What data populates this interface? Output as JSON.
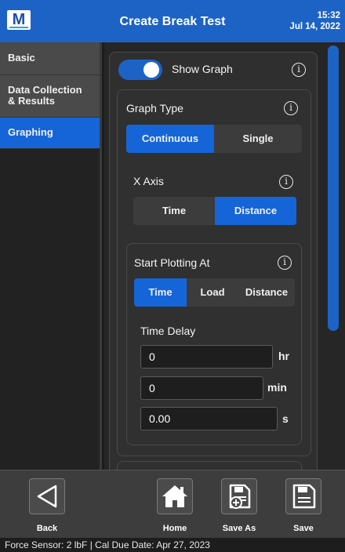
{
  "header": {
    "logo_text": "M",
    "title": "Create Break Test",
    "time": "15:32",
    "date": "Jul 14, 2022"
  },
  "sidebar": {
    "items": [
      {
        "label": "Basic"
      },
      {
        "label": "Data Collection\n& Results"
      },
      {
        "label": "Graphing"
      }
    ]
  },
  "graphing": {
    "show_graph_label": "Show Graph",
    "show_graph_on": true,
    "graph_type": {
      "label": "Graph Type",
      "options": [
        "Continuous",
        "Single"
      ],
      "selected": "Continuous"
    },
    "x_axis": {
      "label": "X Axis",
      "options": [
        "Time",
        "Distance"
      ],
      "selected": "Distance"
    },
    "start_plotting": {
      "label": "Start Plotting At",
      "options": [
        "Time",
        "Load",
        "Distance"
      ],
      "selected": "Time"
    },
    "time_delay": {
      "label": "Time Delay",
      "hours": "0",
      "hours_unit": "hr",
      "minutes": "0",
      "minutes_unit": "min",
      "seconds": "0.00",
      "seconds_unit": "s"
    }
  },
  "footer": {
    "back_label": "Back",
    "home_label": "Home",
    "save_as_label": "Save As",
    "save_label": "Save"
  },
  "status_bar": {
    "text": "Force Sensor: 2 lbF  |  Cal Due Date: Apr 27, 2023"
  },
  "colors": {
    "accent": "#1565d8",
    "header": "#1d63c6"
  },
  "icons": [
    "info-icon",
    "back-triangle-icon",
    "home-icon",
    "save-as-icon",
    "save-icon"
  ]
}
